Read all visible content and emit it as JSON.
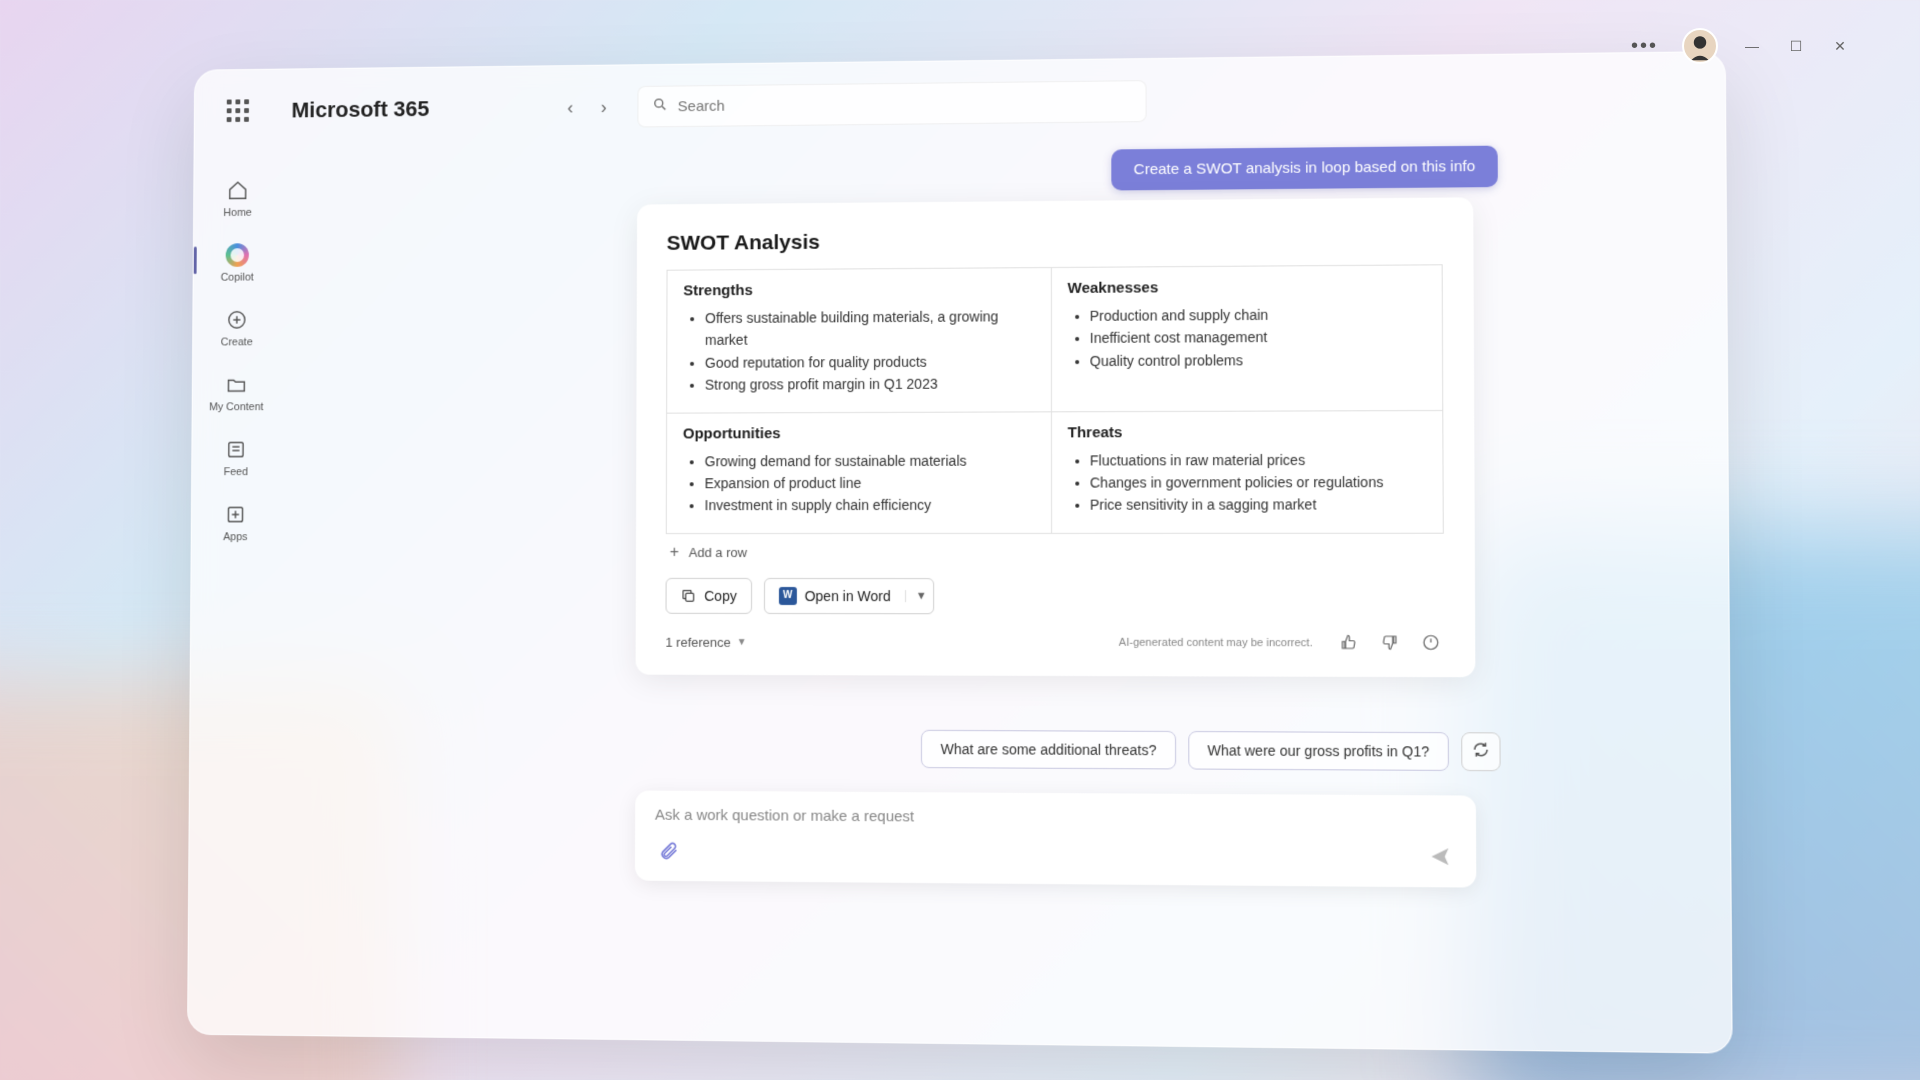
{
  "app": {
    "title": "Microsoft 365"
  },
  "search": {
    "placeholder": "Search"
  },
  "sidebar": {
    "items": [
      {
        "label": "Home"
      },
      {
        "label": "Copilot"
      },
      {
        "label": "Create"
      },
      {
        "label": "My Content"
      },
      {
        "label": "Feed"
      },
      {
        "label": "Apps"
      }
    ]
  },
  "chat": {
    "userMessage": "Create a SWOT analysis in loop based on this info",
    "card": {
      "title": "SWOT Analysis",
      "quadrants": {
        "strengths": {
          "title": "Strengths",
          "items": [
            "Offers sustainable building materials, a growing market",
            "Good reputation for quality products",
            "Strong gross profit margin in Q1 2023"
          ]
        },
        "weaknesses": {
          "title": "Weaknesses",
          "items": [
            "Production and supply chain",
            "Inefficient cost management",
            "Quality control problems"
          ]
        },
        "opportunities": {
          "title": "Opportunities",
          "items": [
            "Growing demand for sustainable materials",
            "Expansion of product line",
            "Investment in supply chain efficiency"
          ]
        },
        "threats": {
          "title": "Threats",
          "items": [
            "Fluctuations in raw material prices",
            "Changes in government policies or regulations",
            "Price sensitivity in a sagging market"
          ]
        }
      },
      "addRow": "Add a row",
      "copy": "Copy",
      "openInWord": "Open in Word",
      "references": "1 reference",
      "disclaimer": "AI-generated content may be incorrect."
    },
    "suggestions": [
      "What are some additional threats?",
      "What were our gross profits in Q1?"
    ],
    "inputPlaceholder": "Ask a work question or make a request"
  }
}
